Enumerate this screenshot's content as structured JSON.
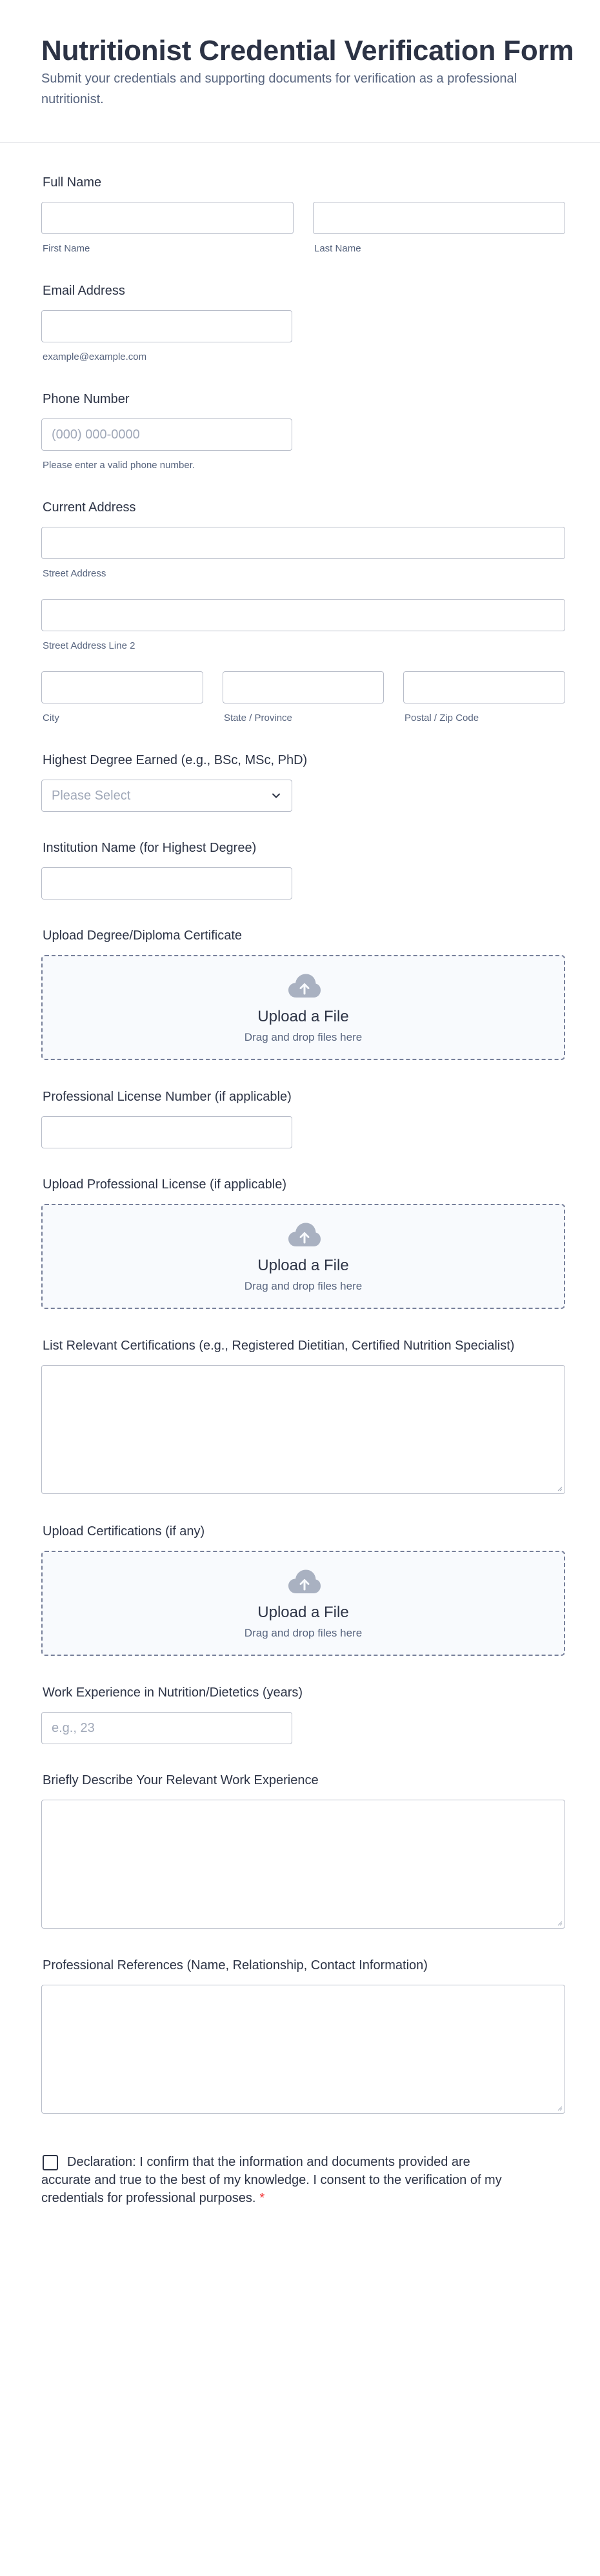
{
  "form": {
    "title": "Nutritionist Credential Verification Form",
    "subtitle": "Submit your credentials and supporting documents for verification as a professional nutritionist."
  },
  "full_name": {
    "label": "Full Name",
    "first_sublabel": "First Name",
    "last_sublabel": "Last Name"
  },
  "email": {
    "label": "Email Address",
    "sublabel": "example@example.com"
  },
  "phone": {
    "label": "Phone Number",
    "placeholder": "(000) 000-0000",
    "sublabel": "Please enter a valid phone number."
  },
  "address": {
    "label": "Current Address",
    "street_sublabel": "Street Address",
    "street2_sublabel": "Street Address Line 2",
    "city_sublabel": "City",
    "state_sublabel": "State / Province",
    "zip_sublabel": "Postal / Zip Code"
  },
  "degree": {
    "label": "Highest Degree Earned (e.g., BSc, MSc, PhD)",
    "selected": "Please Select"
  },
  "institution": {
    "label": "Institution Name (for Highest Degree)"
  },
  "degree_upload": {
    "label": "Upload Degree/Diploma Certificate",
    "title": "Upload a File",
    "hint": "Drag and drop files here",
    "icon": "cloud-upload-icon"
  },
  "license_number": {
    "label": "Professional License Number (if applicable)"
  },
  "license_upload": {
    "label": "Upload Professional License (if applicable)",
    "title": "Upload a File",
    "hint": "Drag and drop files here",
    "icon": "cloud-upload-icon"
  },
  "certifications": {
    "label": "List Relevant Certifications (e.g., Registered Dietitian, Certified Nutrition Specialist)"
  },
  "cert_upload": {
    "label": "Upload Certifications (if any)",
    "title": "Upload a File",
    "hint": "Drag and drop files here",
    "icon": "cloud-upload-icon"
  },
  "experience_years": {
    "label": "Work Experience in Nutrition/Dietetics (years)",
    "placeholder": "e.g., 23"
  },
  "experience_desc": {
    "label": "Briefly Describe Your Relevant Work Experience"
  },
  "references": {
    "label": "Professional References (Name, Relationship, Contact Information)"
  },
  "declaration": {
    "text": "Declaration: I confirm that the information and documents provided are accurate and true to the best of my knowledge. I consent to the verification of my credentials for professional purposes.",
    "required_mark": "*"
  },
  "colors": {
    "text": "#2c3345",
    "muted": "#57647e",
    "border": "#b8bdc9",
    "required": "#f23a3c",
    "upload_bg": "#f8fafd"
  }
}
